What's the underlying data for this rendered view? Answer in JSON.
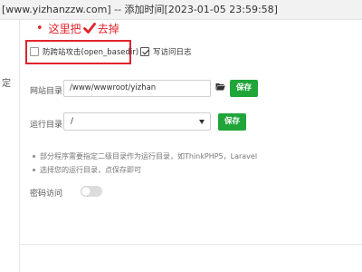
{
  "window": {
    "title": "[www.yizhanzzw.com] -- 添加时间[2023-01-05 23:59:58]"
  },
  "sidebar": {
    "partial_label": "定"
  },
  "annotation": {
    "text_before": "这里把",
    "text_after": "去掉",
    "color": "#e0242b"
  },
  "options": {
    "open_basedir": {
      "label": "防跨站攻击(open_basedir)",
      "checked": false
    },
    "access_log": {
      "label": "写访问日志",
      "checked": true
    }
  },
  "site_dir": {
    "label": "网站目录",
    "value": "/www/wwwroot/yizhan",
    "save_label": "保存"
  },
  "run_dir": {
    "label": "运行目录",
    "selected": "/",
    "save_label": "保存"
  },
  "notes": [
    "部分程序需要指定二级目录作为运行目录，如ThinkPHP5，Laravel",
    "选择您的运行目录，点保存即可"
  ],
  "password_access": {
    "label": "密码访问",
    "enabled": false
  },
  "colors": {
    "accent_green": "#20a53a",
    "annotation_red": "#e0242b"
  },
  "icons": {
    "folder": "folder-open-icon",
    "check": "check-mark-icon",
    "dropdown": "chevron-down-icon"
  }
}
